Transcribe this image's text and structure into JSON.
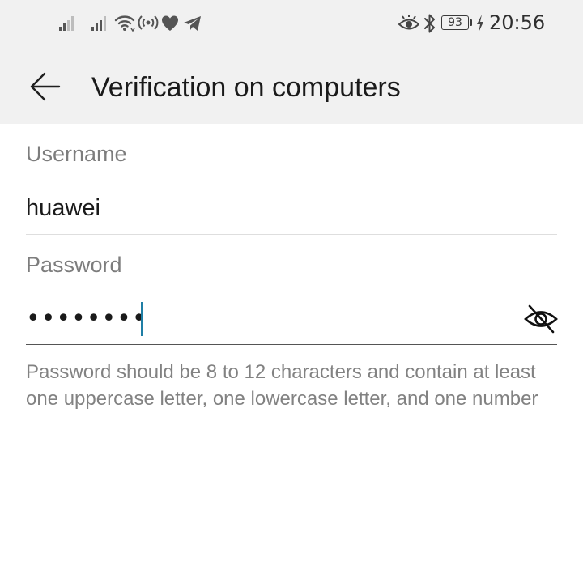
{
  "status_bar": {
    "battery_level": "93",
    "time": "20:56",
    "icons": [
      "signal-1-icon",
      "signal-2-icon",
      "wifi-icon",
      "hotspot-icon",
      "heart-icon",
      "telegram-icon",
      "eye-comfort-icon",
      "bluetooth-icon",
      "battery-icon",
      "charging-icon"
    ]
  },
  "title_bar": {
    "back_icon": "arrow-left-icon",
    "title": "Verification on computers"
  },
  "form": {
    "username": {
      "label": "Username",
      "value": "huawei"
    },
    "password": {
      "label": "Password",
      "masked_value": "••••••••",
      "visibility_icon": "eye-off-icon"
    },
    "helper_text": "Password should be 8 to 12 characters and contain at least one uppercase letter, one lowercase letter, and one number"
  },
  "colors": {
    "header_background": "#f1f1f1",
    "accent_caret": "#1f7ea5",
    "text_primary": "#1a1a1a",
    "text_secondary": "#7d7d7d"
  }
}
